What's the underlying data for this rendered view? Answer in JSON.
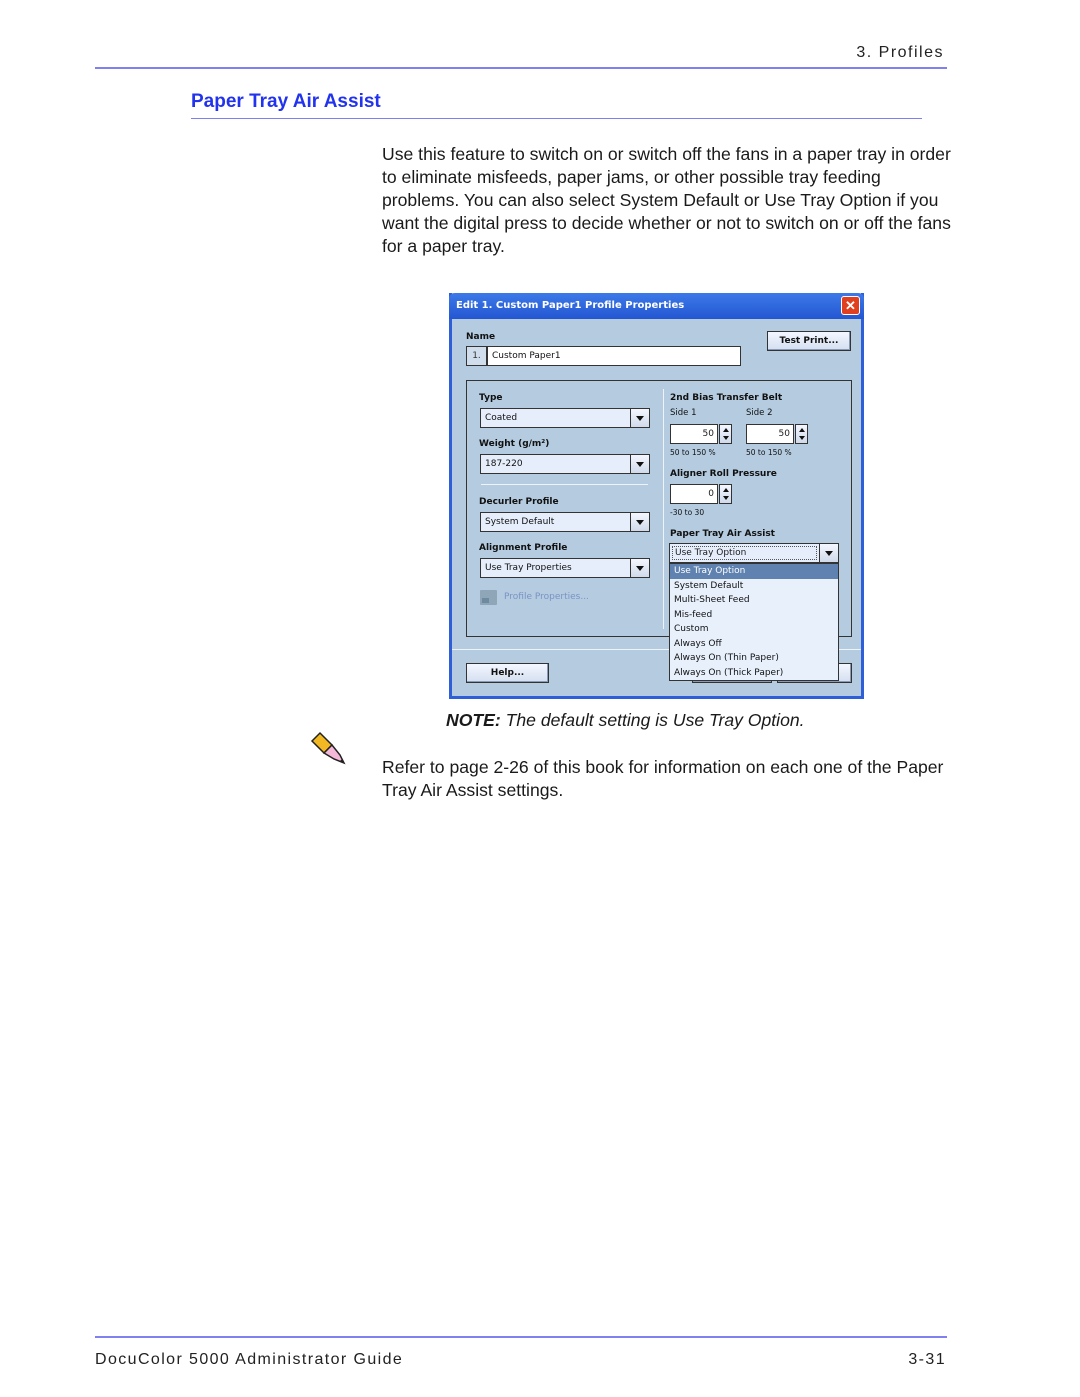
{
  "header": {
    "chapter": "3. Profiles"
  },
  "section": {
    "title": "Paper Tray Air Assist"
  },
  "intro": "Use this feature to switch on or switch off the fans in a paper tray in order to eliminate misfeeds, paper jams, or other possible tray feeding problems.  You can also select System Default or Use Tray Option if you want the digital press to decide whether or not to switch on or off the fans for a paper tray.",
  "dialog": {
    "title": "Edit 1. Custom Paper1 Profile Properties",
    "close_icon": "close-icon",
    "name_label": "Name",
    "name_number": "1.",
    "name_value": "Custom Paper1",
    "test_print_label": "Test Print...",
    "type_label": "Type",
    "type_value": "Coated",
    "weight_label": "Weight (g/m²)",
    "weight_value": "187-220",
    "decurler_label": "Decurler Profile",
    "decurler_value": "System Default",
    "alignment_label": "Alignment Profile",
    "alignment_value": "Use Tray Properties",
    "profile_properties_label": "Profile Properties...",
    "bias_label": "2nd Bias Transfer Belt",
    "side1_label": "Side 1",
    "side1_value": "50",
    "side1_range": "50 to 150 %",
    "side2_label": "Side 2",
    "side2_value": "50",
    "side2_range": "50 to 150 %",
    "aligner_label": "Aligner Roll Pressure",
    "aligner_value": "0",
    "aligner_range": "-30 to 30",
    "air_assist_label": "Paper Tray Air Assist",
    "air_assist_value": "Use Tray Option",
    "air_assist_options": [
      "Use Tray Option",
      "System Default",
      "Multi-Sheet Feed",
      "Mis-feed",
      "Custom",
      "Always Off",
      "Always On (Thin Paper)",
      "Always On (Thick Paper)"
    ],
    "air_assist_selected_index": 0,
    "help_label": "Help..."
  },
  "note": {
    "prefix": "NOTE:",
    "text": " The default setting is Use Tray Option."
  },
  "refer": "Refer to page 2-26 of this book for information on each one of the Paper Tray Air Assist settings.",
  "footer": {
    "title": "DocuColor 5000 Administrator Guide",
    "page": "3-31"
  },
  "colors": {
    "accent_rule": "#8080f0",
    "heading": "#2233ee",
    "dialog_bg": "#b4cbe0",
    "titlebar": "#2f5fd8",
    "selection": "#5f82b0"
  }
}
